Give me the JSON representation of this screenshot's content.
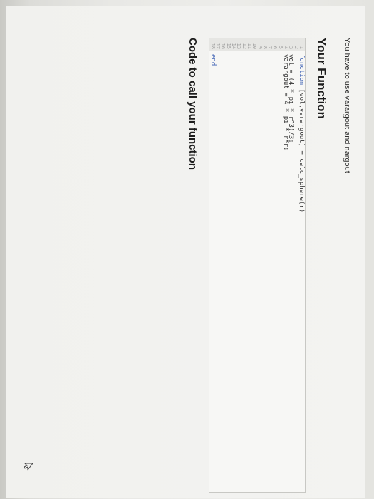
{
  "instruction": "You have to use varargout and nargout",
  "your_function_heading": "Your Function",
  "editor": {
    "lines": [
      {
        "num": "1",
        "kw": "function",
        "text": " [vol,varargout] = calc_sphere(r)"
      },
      {
        "num": "2",
        "kw": "",
        "text": ""
      },
      {
        "num": "3",
        "kw": "",
        "text": "vol = (4 * pi * r^3)/3;"
      },
      {
        "num": "4",
        "kw": "",
        "text": "varargout = 4 * pi * r*r;"
      },
      {
        "num": "5",
        "kw": "",
        "text": ""
      },
      {
        "num": "6",
        "kw": "",
        "text": ""
      },
      {
        "num": "7",
        "kw": "",
        "text": ""
      },
      {
        "num": "8",
        "kw": "",
        "text": ""
      },
      {
        "num": "9",
        "kw": "",
        "text": ""
      },
      {
        "num": "10",
        "kw": "",
        "text": ""
      },
      {
        "num": "11",
        "kw": "",
        "text": ""
      },
      {
        "num": "12",
        "kw": "",
        "text": ""
      },
      {
        "num": "13",
        "kw": "",
        "text": ""
      },
      {
        "num": "14",
        "kw": "",
        "text": ""
      },
      {
        "num": "15",
        "kw": "",
        "text": ""
      },
      {
        "num": "16",
        "kw": "",
        "text": ""
      },
      {
        "num": "17",
        "kw": "",
        "text": ""
      },
      {
        "num": "18",
        "kw": "end",
        "text": ""
      }
    ]
  },
  "call_heading": "Code to call your function",
  "icons": {
    "cursor": "mouse-pointer-icon"
  }
}
